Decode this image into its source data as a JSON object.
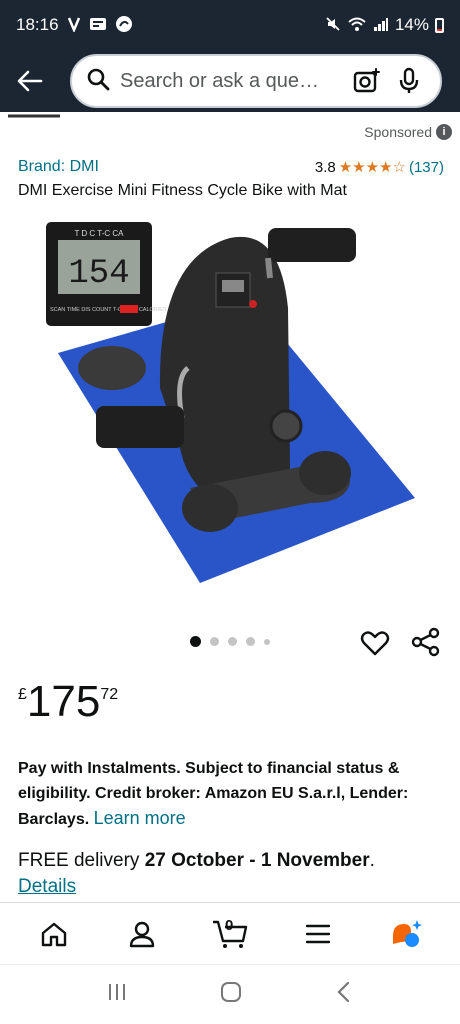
{
  "status_bar": {
    "time": "18:16",
    "left_icons": [
      "v-icon",
      "notification-icon",
      "app-icon"
    ],
    "battery": "14%"
  },
  "search": {
    "placeholder": "Search or ask a que…"
  },
  "product": {
    "sponsored_label": "Sponsored",
    "brand": "Brand: DMI",
    "rating": "3.8",
    "stars": "★★★★☆",
    "review_count": "(137)",
    "title": "DMI Exercise Mini Fitness Cycle Bike with Mat",
    "monitor_labels": "T  D  C  T-C  CA",
    "monitor_display": "154",
    "monitor_footer": "SCAN TIME DIS COUNT T-COUNT CALORIES",
    "image_count": 5,
    "active_image": 0,
    "price": {
      "symbol": "£",
      "whole": "175",
      "fraction": "72"
    },
    "instalments": "Pay with Instalments. Subject to financial status & eligibility. Credit broker: Amazon EU S.a.r.l, Lender: Barclays.",
    "learn_more": "Learn more",
    "delivery_prefix": "FREE delivery ",
    "delivery_dates": "27 October - 1 November",
    "delivery_suffix": ".",
    "details_link": "Details"
  },
  "bottom_nav": {
    "items": [
      "home-icon",
      "account-icon",
      "cart-icon",
      "menu-icon",
      "rufus-icon"
    ],
    "cart_count": "0"
  },
  "colors": {
    "header_bg": "#1b2632",
    "link": "#007185",
    "star": "#de7921",
    "mat": "#2a55c8"
  }
}
